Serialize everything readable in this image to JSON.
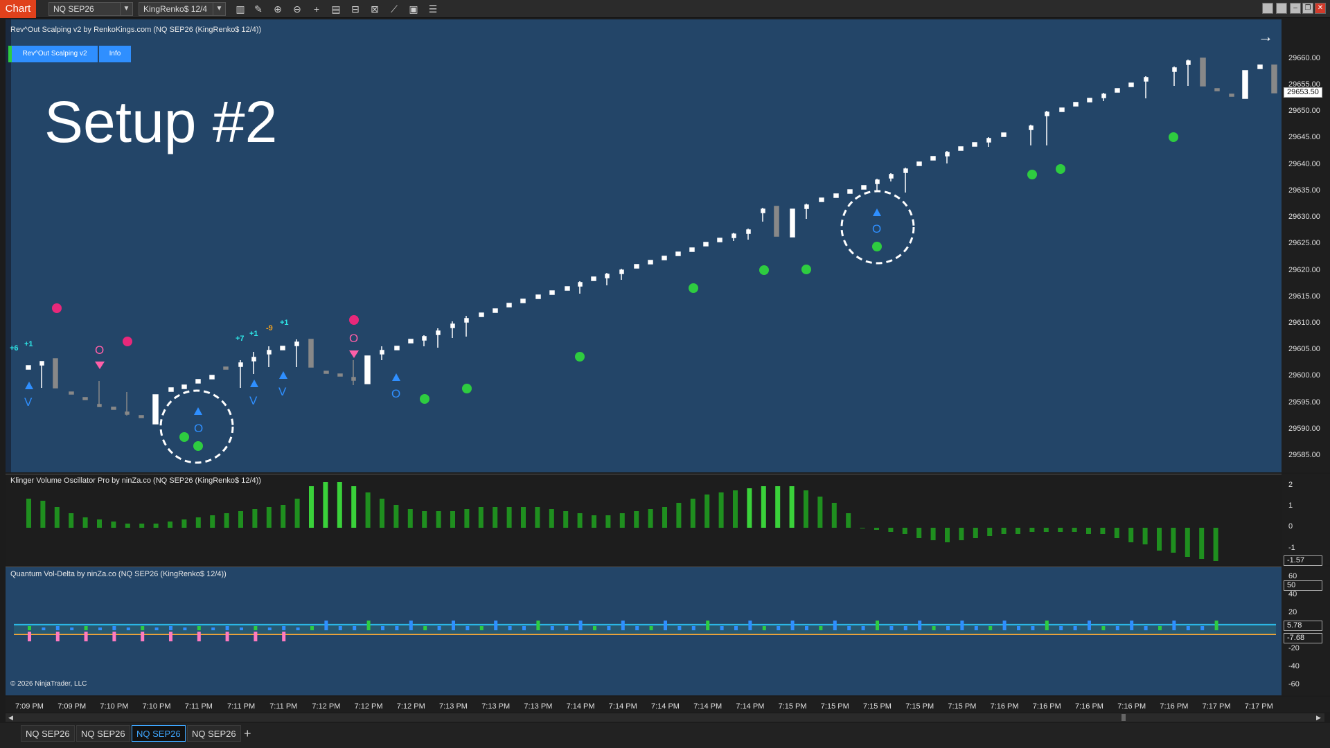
{
  "toolbar": {
    "chart_tag": "Chart",
    "instrument": "NQ SEP26",
    "bar_type": "KingRenko$ 12/4"
  },
  "price_pane": {
    "label": "Rev^Out Scalping v2 by RenkoKings.com (NQ SEP26 (KingRenko$ 12/4))",
    "btn_main": "Rev^Out Scalping v2",
    "btn_info": "Info",
    "overlay_text": "Setup #2",
    "axis": [
      "29660.00",
      "29655.00",
      "29650.00",
      "29645.00",
      "29640.00",
      "29635.00",
      "29630.00",
      "29625.00",
      "29620.00",
      "29615.00",
      "29610.00",
      "29605.00",
      "29600.00",
      "29595.00",
      "29590.00",
      "29585.00"
    ],
    "last_price": "29653.50",
    "annotations": [
      {
        "text": "+6",
        "color": "#2ee6e6"
      },
      {
        "text": "+1",
        "color": "#2ee6e6"
      },
      {
        "text": "+7",
        "color": "#2ee6e6"
      },
      {
        "text": "+1",
        "color": "#2ee6e6"
      },
      {
        "text": "-9",
        "color": "#f0a020"
      },
      {
        "text": "+1",
        "color": "#2ee6e6"
      }
    ]
  },
  "klinger_pane": {
    "label": "Klinger Volume Oscillator Pro by ninZa.co (NQ SEP26 (KingRenko$ 12/4))",
    "axis": [
      "2",
      "1",
      "0",
      "-1"
    ],
    "last_value": "-1.57"
  },
  "delta_pane": {
    "label": "Quantum Vol-Delta by ninZa.co (NQ SEP26 (KingRenko$ 12/4))",
    "axis": [
      "60",
      "40",
      "20",
      "-20",
      "-40",
      "-60"
    ],
    "flags": [
      "50",
      "5.78",
      "-7.68"
    ],
    "copyright": "© 2026 NinjaTrader, LLC"
  },
  "time_axis": [
    "7:09 PM",
    "7:09 PM",
    "7:10 PM",
    "7:10 PM",
    "7:11 PM",
    "7:11 PM",
    "7:11 PM",
    "7:12 PM",
    "7:12 PM",
    "7:12 PM",
    "7:13 PM",
    "7:13 PM",
    "7:13 PM",
    "7:14 PM",
    "7:14 PM",
    "7:14 PM",
    "7:14 PM",
    "7:14 PM",
    "7:15 PM",
    "7:15 PM",
    "7:15 PM",
    "7:15 PM",
    "7:15 PM",
    "7:16 PM",
    "7:16 PM",
    "7:16 PM",
    "7:16 PM",
    "7:16 PM",
    "7:17 PM",
    "7:17 PM"
  ],
  "tabs": [
    "NQ SEP26",
    "NQ SEP26",
    "NQ SEP26",
    "NQ SEP26"
  ],
  "colors": {
    "price_bg": "#234568",
    "osc_bg": "#1d1d1d",
    "bull_dot": "#2ecc40",
    "bear_dot": "#e8287a",
    "signal_blue": "#2f8fff",
    "signal_pink": "#ff5fa8"
  }
}
